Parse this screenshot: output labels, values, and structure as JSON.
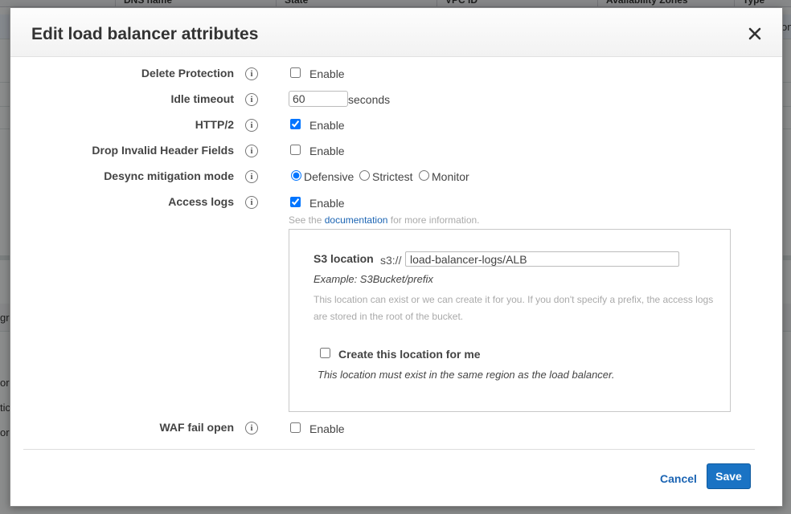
{
  "background": {
    "columns": [
      "DNS name",
      "State",
      "VPC ID",
      "Availability Zones",
      "Type"
    ],
    "fragments_left": [
      "gr",
      "or",
      "tic",
      "or"
    ],
    "fragments_right": [
      "on"
    ]
  },
  "modal": {
    "title": "Edit load balancer attributes",
    "close_icon": "close-icon"
  },
  "attributes": {
    "delete_protection": {
      "label": "Delete Protection",
      "option": "Enable",
      "checked": false
    },
    "idle_timeout": {
      "label": "Idle timeout",
      "value": "60",
      "units": "seconds"
    },
    "http2": {
      "label": "HTTP/2",
      "option": "Enable",
      "checked": true
    },
    "drop_invalid": {
      "label": "Drop Invalid Header Fields",
      "option": "Enable",
      "checked": false
    },
    "desync": {
      "label": "Desync mitigation mode",
      "options": [
        "Defensive",
        "Strictest",
        "Monitor"
      ],
      "selected": "Defensive"
    },
    "access_logs": {
      "label": "Access logs",
      "option": "Enable",
      "checked": true,
      "hint_pre": "See the",
      "hint_link": "documentation",
      "hint_post": "for more information."
    },
    "waf": {
      "label": "WAF fail open",
      "option": "Enable",
      "checked": false
    }
  },
  "s3": {
    "label": "S3 location",
    "prefix": "s3://",
    "value": "load-balancer-logs/ALB",
    "example": "Example: S3Bucket/prefix",
    "help": "This location can exist or we can create it for you. If you don't specify a prefix, the access logs are stored in the root of the bucket.",
    "create_label": "Create this location for me",
    "create_checked": false,
    "create_note": "This location must exist in the same region as the load balancer."
  },
  "footer": {
    "cancel": "Cancel",
    "save": "Save"
  },
  "colors": {
    "link": "#1b64b3",
    "primary_button": "#1a73c4"
  }
}
